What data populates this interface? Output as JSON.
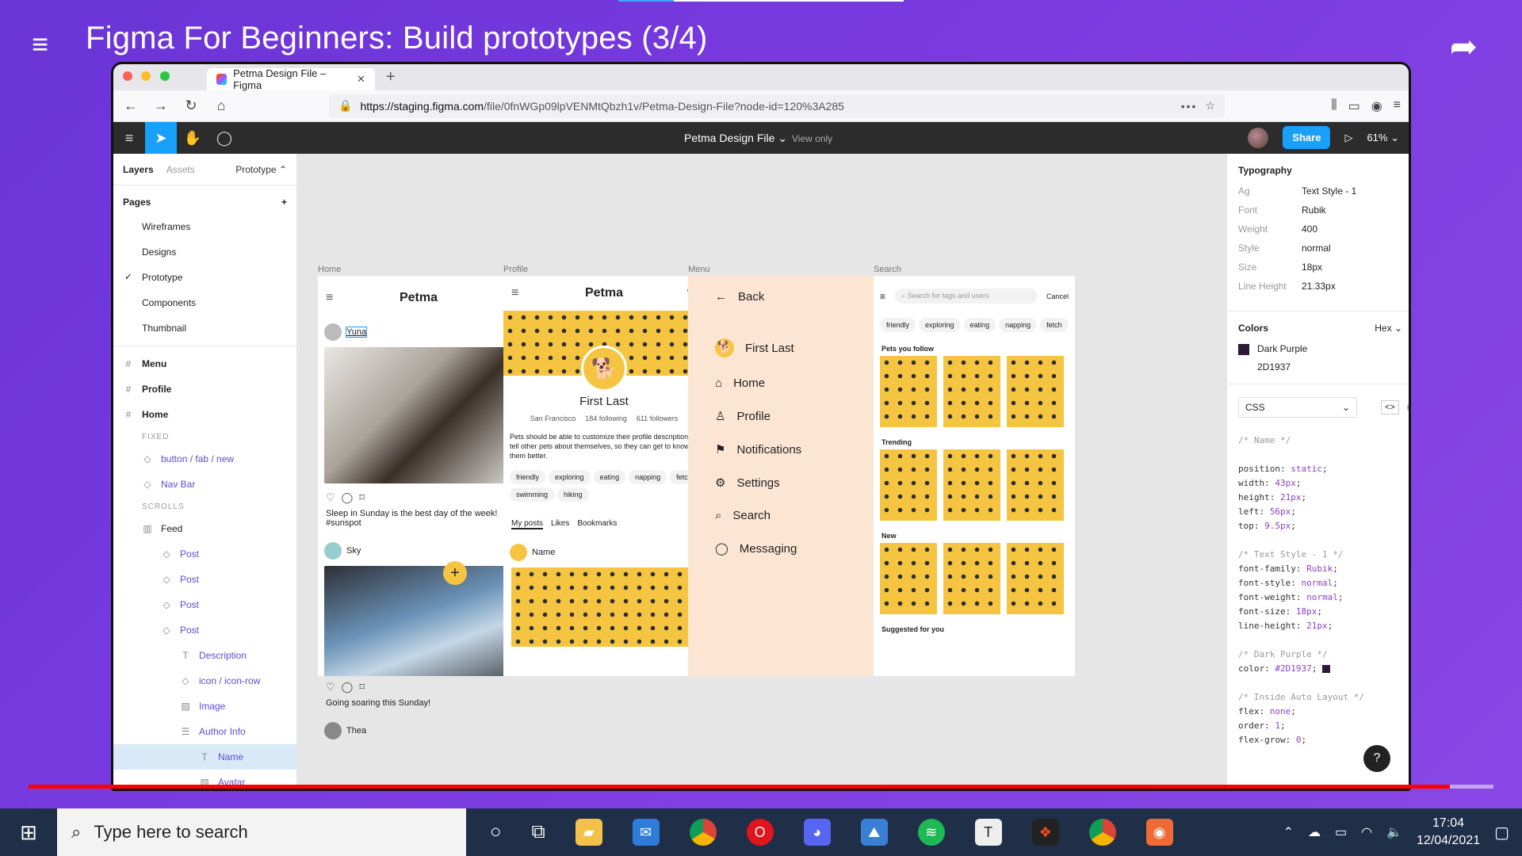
{
  "video": {
    "title": "Figma For Beginners: Build prototypes (3/4)",
    "progress": 0.97
  },
  "browser": {
    "tab_title": "Petma Design File – Figma",
    "url_domain": "https://staging.figma.com",
    "url_rest": "/file/0fnWGp09lpVENMtQbzh1v/Petma-Design-File?node-id=120%3A285"
  },
  "figma": {
    "file_name": "Petma Design File",
    "view_only": "View only",
    "share": "Share",
    "zoom": "61%"
  },
  "left_panel": {
    "tabs": {
      "layers": "Layers",
      "assets": "Assets",
      "mode": "Prototype"
    },
    "pages_header": "Pages",
    "pages": [
      "Wireframes",
      "Designs",
      "Prototype",
      "Components",
      "Thumbnail"
    ],
    "frames": [
      "Menu",
      "Profile",
      "Home"
    ],
    "fixed_label": "FIXED",
    "fixed": [
      "button / fab / new",
      "Nav Bar"
    ],
    "scrolls_label": "SCROLLS",
    "feed": "Feed",
    "posts": [
      "Post",
      "Post",
      "Post",
      "Post"
    ],
    "post_children": [
      "Description",
      "icon / icon-row",
      "Image",
      "Author Info",
      "Name",
      "Avatar"
    ]
  },
  "canvas": {
    "labels": {
      "home": "Home",
      "profile": "Profile",
      "menu": "Menu",
      "search": "Search"
    },
    "home": {
      "brand": "Petma",
      "post1_author": "Yuna",
      "post1_caption": "Sleep in Sunday is the best day of the week! #sunspot",
      "post2_author": "Sky",
      "post2_caption": "Going soaring this Sunday!",
      "post3_author": "Thea"
    },
    "profile": {
      "brand": "Petma",
      "name": "First Last",
      "location": "San Francisco",
      "following": "184 following",
      "followers": "611 followers",
      "bio": "Pets should be able to customize their profile description to tell other pets about themselves, so they can get to know them better.",
      "tags": [
        "friendly",
        "exploring",
        "eating",
        "napping",
        "fetch",
        "swimming",
        "hiking"
      ],
      "tabs": [
        "My posts",
        "Likes",
        "Bookmarks"
      ],
      "post_name": "Name"
    },
    "menu": {
      "back": "Back",
      "user": "First Last",
      "items": [
        "Home",
        "Profile",
        "Notifications",
        "Settings",
        "Search",
        "Messaging"
      ]
    },
    "search": {
      "placeholder": "Search for tags and users",
      "cancel": "Cancel",
      "chips": [
        "friendly",
        "exploring",
        "eating",
        "napping",
        "fetch"
      ],
      "sections": [
        "Pets you follow",
        "Trending",
        "New",
        "Suggested for you"
      ]
    }
  },
  "right_panel": {
    "typography": "Typography",
    "props": [
      {
        "k": "Ag",
        "v": "Text Style - 1"
      },
      {
        "k": "Font",
        "v": "Rubik"
      },
      {
        "k": "Weight",
        "v": "400"
      },
      {
        "k": "Style",
        "v": "normal"
      },
      {
        "k": "Size",
        "v": "18px"
      },
      {
        "k": "Line Height",
        "v": "21.33px"
      }
    ],
    "colors": "Colors",
    "color_format": "Hex",
    "color_name": "Dark Purple",
    "color_hex": "2D1937",
    "color_value": "#2d1937",
    "code_lang": "CSS"
  },
  "taskbar": {
    "search_placeholder": "Type here to search",
    "time": "17:04",
    "date": "12/04/2021"
  }
}
